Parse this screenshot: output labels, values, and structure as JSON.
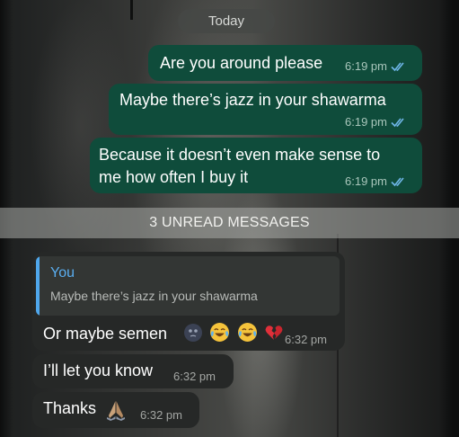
{
  "date_separator": "Today",
  "outgoing": [
    {
      "text": "Are you around please",
      "time": "6:19 pm"
    },
    {
      "text": "Maybe there’s jazz in your shawarma",
      "time": "6:19 pm"
    },
    {
      "text_line1": "Because it doesn’t even make sense to",
      "text_line2": "me how often I buy it",
      "time": "6:19 pm"
    }
  ],
  "unread_separator": "3 UNREAD MESSAGES",
  "incoming": {
    "reply_quote": {
      "author": "You",
      "text": "Maybe there’s jazz in your shawarma"
    },
    "first": {
      "text": "Or maybe semen",
      "time": "6:32 pm",
      "emojis": [
        "new-moon-face",
        "face-with-tears-of-joy",
        "face-with-tears-of-joy",
        "broken-heart"
      ]
    },
    "second": {
      "text": "I’ll let you know",
      "time": "6:32 pm"
    },
    "third": {
      "text": "Thanks",
      "time": "6:32 pm",
      "emojis": [
        "folded-hands"
      ]
    }
  },
  "colors": {
    "outgoing_bubble": "#0f4c3b",
    "incoming_bubble": "#262827",
    "read_ticks": "#6fb6e8",
    "quote_accent": "#4fa7ec"
  }
}
